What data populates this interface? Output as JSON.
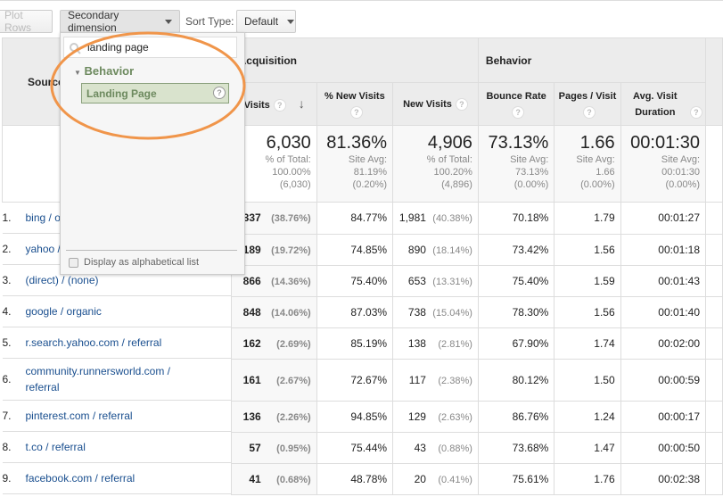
{
  "toolbar": {
    "plot_rows": "Plot Rows",
    "secondary_dimension": "Secondary dimension",
    "sort_type_label": "Sort Type:",
    "sort_type_value": "Default"
  },
  "dropdown": {
    "search_value": "landing page",
    "group": "Behavior",
    "item": "Landing Page",
    "checkbox_label": "Display as alphabetical list"
  },
  "table": {
    "source_header": "Source",
    "groups": [
      "Acquisition",
      "Behavior"
    ],
    "columns": [
      "Visits",
      "% New Visits",
      "New Visits",
      "Bounce Rate",
      "Pages / Visit",
      "Avg. Visit Duration"
    ],
    "sort_column": "Visits",
    "totals": [
      {
        "value": "6,030",
        "l1": "% of Total:",
        "l2": "100.00%",
        "l3": "(6,030)"
      },
      {
        "value": "81.36%",
        "l1": "Site Avg:",
        "l2": "81.19%",
        "l3": "(0.20%)"
      },
      {
        "value": "4,906",
        "l1": "% of Total:",
        "l2": "100.20%",
        "l3": "(4,896)"
      },
      {
        "value": "73.13%",
        "l1": "Site Avg:",
        "l2": "73.13%",
        "l3": "(0.00%)"
      },
      {
        "value": "1.66",
        "l1": "Site Avg:",
        "l2": "1.66",
        "l3": "(0.00%)"
      },
      {
        "value": "00:01:30",
        "l1": "Site Avg:",
        "l2": "00:01:30",
        "l3": "(0.00%)"
      }
    ],
    "rows": [
      {
        "idx": "1.",
        "source": "bing / organic",
        "visits": "2,337",
        "visits_pct": "(38.76%)",
        "new_pct": "84.77%",
        "new": "1,981",
        "new_share": "(40.38%)",
        "bounce": "70.18%",
        "pages": "1.79",
        "dur": "00:01:27"
      },
      {
        "idx": "2.",
        "source": "yahoo / organic",
        "visits": "1,189",
        "visits_pct": "(19.72%)",
        "new_pct": "74.85%",
        "new": "890",
        "new_share": "(18.14%)",
        "bounce": "73.42%",
        "pages": "1.56",
        "dur": "00:01:18"
      },
      {
        "idx": "3.",
        "source": "(direct) / (none)",
        "visits": "866",
        "visits_pct": "(14.36%)",
        "new_pct": "75.40%",
        "new": "653",
        "new_share": "(13.31%)",
        "bounce": "75.40%",
        "pages": "1.59",
        "dur": "00:01:43"
      },
      {
        "idx": "4.",
        "source": "google / organic",
        "visits": "848",
        "visits_pct": "(14.06%)",
        "new_pct": "87.03%",
        "new": "738",
        "new_share": "(15.04%)",
        "bounce": "78.30%",
        "pages": "1.56",
        "dur": "00:01:40"
      },
      {
        "idx": "5.",
        "source": "r.search.yahoo.com / referral",
        "visits": "162",
        "visits_pct": "(2.69%)",
        "new_pct": "85.19%",
        "new": "138",
        "new_share": "(2.81%)",
        "bounce": "67.90%",
        "pages": "1.74",
        "dur": "00:02:00"
      },
      {
        "idx": "6.",
        "source": "community.runnersworld.com / referral",
        "visits": "161",
        "visits_pct": "(2.67%)",
        "new_pct": "72.67%",
        "new": "117",
        "new_share": "(2.38%)",
        "bounce": "80.12%",
        "pages": "1.50",
        "dur": "00:00:59"
      },
      {
        "idx": "7.",
        "source": "pinterest.com / referral",
        "visits": "136",
        "visits_pct": "(2.26%)",
        "new_pct": "94.85%",
        "new": "129",
        "new_share": "(2.63%)",
        "bounce": "86.76%",
        "pages": "1.24",
        "dur": "00:00:17"
      },
      {
        "idx": "8.",
        "source": "t.co / referral",
        "visits": "57",
        "visits_pct": "(0.95%)",
        "new_pct": "75.44%",
        "new": "43",
        "new_share": "(0.88%)",
        "bounce": "73.68%",
        "pages": "1.47",
        "dur": "00:00:50"
      },
      {
        "idx": "9.",
        "source": "facebook.com / referral",
        "visits": "41",
        "visits_pct": "(0.68%)",
        "new_pct": "48.78%",
        "new": "20",
        "new_share": "(0.41%)",
        "bounce": "75.61%",
        "pages": "1.76",
        "dur": "00:02:38"
      }
    ]
  },
  "colors": {
    "highlight_ellipse": "#f0954a",
    "dimension_green": "#6d8a5f",
    "link": "#1a4f8f"
  }
}
